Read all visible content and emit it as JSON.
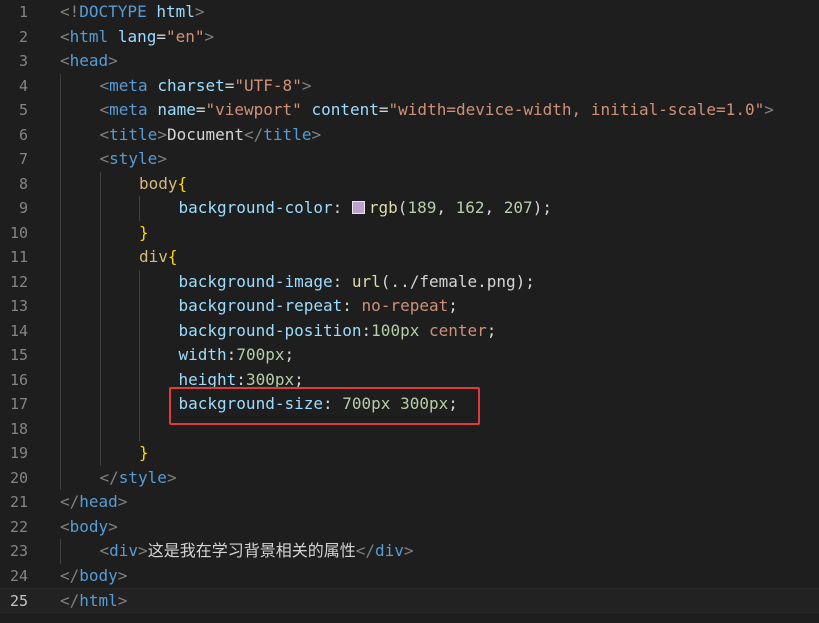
{
  "editor": {
    "active_line": 25,
    "highlight_color": "#e03b3b",
    "colors": {
      "background": "#1e1e1e",
      "tag": "#569cd6",
      "attribute": "#9cdcfe",
      "string": "#ce9178",
      "selector": "#d7ba7d",
      "number": "#b5cea8",
      "function": "#dcdcaa",
      "swatch": "#bda2cf"
    },
    "lines": [
      {
        "n": "1",
        "tokens": [
          {
            "t": "<!",
            "c": "pu"
          },
          {
            "t": "DOCTYPE",
            "c": "tg"
          },
          {
            "t": " ",
            "c": "tx"
          },
          {
            "t": "html",
            "c": "at"
          },
          {
            "t": ">",
            "c": "pu"
          }
        ]
      },
      {
        "n": "2",
        "tokens": [
          {
            "t": "<",
            "c": "pu"
          },
          {
            "t": "html",
            "c": "tg"
          },
          {
            "t": " ",
            "c": "tx"
          },
          {
            "t": "lang",
            "c": "at"
          },
          {
            "t": "=",
            "c": "tx"
          },
          {
            "t": "\"en\"",
            "c": "sv"
          },
          {
            "t": ">",
            "c": "pu"
          }
        ]
      },
      {
        "n": "3",
        "tokens": [
          {
            "t": "<",
            "c": "pu"
          },
          {
            "t": "head",
            "c": "tg"
          },
          {
            "t": ">",
            "c": "pu"
          }
        ]
      },
      {
        "n": "4",
        "indent": 1,
        "tokens": [
          {
            "t": "<",
            "c": "pu"
          },
          {
            "t": "meta",
            "c": "tg"
          },
          {
            "t": " ",
            "c": "tx"
          },
          {
            "t": "charset",
            "c": "at"
          },
          {
            "t": "=",
            "c": "tx"
          },
          {
            "t": "\"UTF-8\"",
            "c": "sv"
          },
          {
            "t": ">",
            "c": "pu"
          }
        ]
      },
      {
        "n": "5",
        "indent": 1,
        "tokens": [
          {
            "t": "<",
            "c": "pu"
          },
          {
            "t": "meta",
            "c": "tg"
          },
          {
            "t": " ",
            "c": "tx"
          },
          {
            "t": "name",
            "c": "at"
          },
          {
            "t": "=",
            "c": "tx"
          },
          {
            "t": "\"viewport\"",
            "c": "sv"
          },
          {
            "t": " ",
            "c": "tx"
          },
          {
            "t": "content",
            "c": "at"
          },
          {
            "t": "=",
            "c": "tx"
          },
          {
            "t": "\"width=device-width, initial-scale=1.0\"",
            "c": "sv"
          },
          {
            "t": ">",
            "c": "pu"
          }
        ]
      },
      {
        "n": "6",
        "indent": 1,
        "tokens": [
          {
            "t": "<",
            "c": "pu"
          },
          {
            "t": "title",
            "c": "tg"
          },
          {
            "t": ">",
            "c": "pu"
          },
          {
            "t": "Document",
            "c": "tx"
          },
          {
            "t": "</",
            "c": "pu"
          },
          {
            "t": "title",
            "c": "tg"
          },
          {
            "t": ">",
            "c": "pu"
          }
        ]
      },
      {
        "n": "7",
        "indent": 1,
        "tokens": [
          {
            "t": "<",
            "c": "pu"
          },
          {
            "t": "style",
            "c": "tg"
          },
          {
            "t": ">",
            "c": "pu"
          }
        ]
      },
      {
        "n": "8",
        "indent": 2,
        "tokens": [
          {
            "t": "body",
            "c": "sl"
          },
          {
            "t": "{",
            "c": "br"
          }
        ]
      },
      {
        "n": "9",
        "indent": 3,
        "tokens": [
          {
            "t": "background-color",
            "c": "pr"
          },
          {
            "t": ": ",
            "c": "tx"
          },
          {
            "t": "",
            "c": "swatch"
          },
          {
            "t": "rgb",
            "c": "fn"
          },
          {
            "t": "(",
            "c": "tx"
          },
          {
            "t": "189",
            "c": "nm"
          },
          {
            "t": ", ",
            "c": "tx"
          },
          {
            "t": "162",
            "c": "nm"
          },
          {
            "t": ", ",
            "c": "tx"
          },
          {
            "t": "207",
            "c": "nm"
          },
          {
            "t": ");",
            "c": "tx"
          }
        ]
      },
      {
        "n": "10",
        "indent": 2,
        "tokens": [
          {
            "t": "}",
            "c": "br"
          }
        ]
      },
      {
        "n": "11",
        "indent": 2,
        "tokens": [
          {
            "t": "div",
            "c": "sl"
          },
          {
            "t": "{",
            "c": "br"
          }
        ]
      },
      {
        "n": "12",
        "indent": 3,
        "tokens": [
          {
            "t": "background-image",
            "c": "pr"
          },
          {
            "t": ": ",
            "c": "tx"
          },
          {
            "t": "url",
            "c": "fn"
          },
          {
            "t": "(../female.png)",
            "c": "tx"
          },
          {
            "t": ";",
            "c": "tx"
          }
        ]
      },
      {
        "n": "13",
        "indent": 3,
        "tokens": [
          {
            "t": "background-repeat",
            "c": "pr"
          },
          {
            "t": ": ",
            "c": "tx"
          },
          {
            "t": "no-repeat",
            "c": "sv"
          },
          {
            "t": ";",
            "c": "tx"
          }
        ]
      },
      {
        "n": "14",
        "indent": 3,
        "tokens": [
          {
            "t": "background-position",
            "c": "pr"
          },
          {
            "t": ":",
            "c": "tx"
          },
          {
            "t": "100px",
            "c": "nm"
          },
          {
            "t": " ",
            "c": "tx"
          },
          {
            "t": "center",
            "c": "sv"
          },
          {
            "t": ";",
            "c": "tx"
          }
        ]
      },
      {
        "n": "15",
        "indent": 3,
        "tokens": [
          {
            "t": "width",
            "c": "pr"
          },
          {
            "t": ":",
            "c": "tx"
          },
          {
            "t": "700px",
            "c": "nm"
          },
          {
            "t": ";",
            "c": "tx"
          }
        ]
      },
      {
        "n": "16",
        "indent": 3,
        "tokens": [
          {
            "t": "height",
            "c": "pr"
          },
          {
            "t": ":",
            "c": "tx"
          },
          {
            "t": "300px",
            "c": "nm"
          },
          {
            "t": ";",
            "c": "tx"
          }
        ]
      },
      {
        "n": "17",
        "indent": 3,
        "highlighted": true,
        "tokens": [
          {
            "t": "background-size",
            "c": "pr"
          },
          {
            "t": ": ",
            "c": "tx"
          },
          {
            "t": "700px",
            "c": "nm"
          },
          {
            "t": " ",
            "c": "tx"
          },
          {
            "t": "300px",
            "c": "nm"
          },
          {
            "t": ";",
            "c": "tx"
          }
        ]
      },
      {
        "n": "18",
        "indent": 3,
        "tokens": []
      },
      {
        "n": "19",
        "indent": 2,
        "tokens": [
          {
            "t": "}",
            "c": "br"
          }
        ]
      },
      {
        "n": "20",
        "indent": 1,
        "tokens": [
          {
            "t": "</",
            "c": "pu"
          },
          {
            "t": "style",
            "c": "tg"
          },
          {
            "t": ">",
            "c": "pu"
          }
        ]
      },
      {
        "n": "21",
        "tokens": [
          {
            "t": "</",
            "c": "pu"
          },
          {
            "t": "head",
            "c": "tg"
          },
          {
            "t": ">",
            "c": "pu"
          }
        ]
      },
      {
        "n": "22",
        "tokens": [
          {
            "t": "<",
            "c": "pu"
          },
          {
            "t": "body",
            "c": "tg"
          },
          {
            "t": ">",
            "c": "pu"
          }
        ]
      },
      {
        "n": "23",
        "indent": 1,
        "tokens": [
          {
            "t": "<",
            "c": "pu"
          },
          {
            "t": "div",
            "c": "tg"
          },
          {
            "t": ">",
            "c": "pu"
          },
          {
            "t": "这是我在学习背景相关的属性",
            "c": "tx cjk"
          },
          {
            "t": "</",
            "c": "pu"
          },
          {
            "t": "div",
            "c": "tg"
          },
          {
            "t": ">",
            "c": "pu"
          }
        ]
      },
      {
        "n": "24",
        "tokens": [
          {
            "t": "</",
            "c": "pu"
          },
          {
            "t": "body",
            "c": "tg"
          },
          {
            "t": ">",
            "c": "pu"
          }
        ]
      },
      {
        "n": "25",
        "tokens": [
          {
            "t": "</",
            "c": "pu"
          },
          {
            "t": "html",
            "c": "tg"
          },
          {
            "t": ">",
            "c": "pu"
          }
        ]
      }
    ]
  }
}
